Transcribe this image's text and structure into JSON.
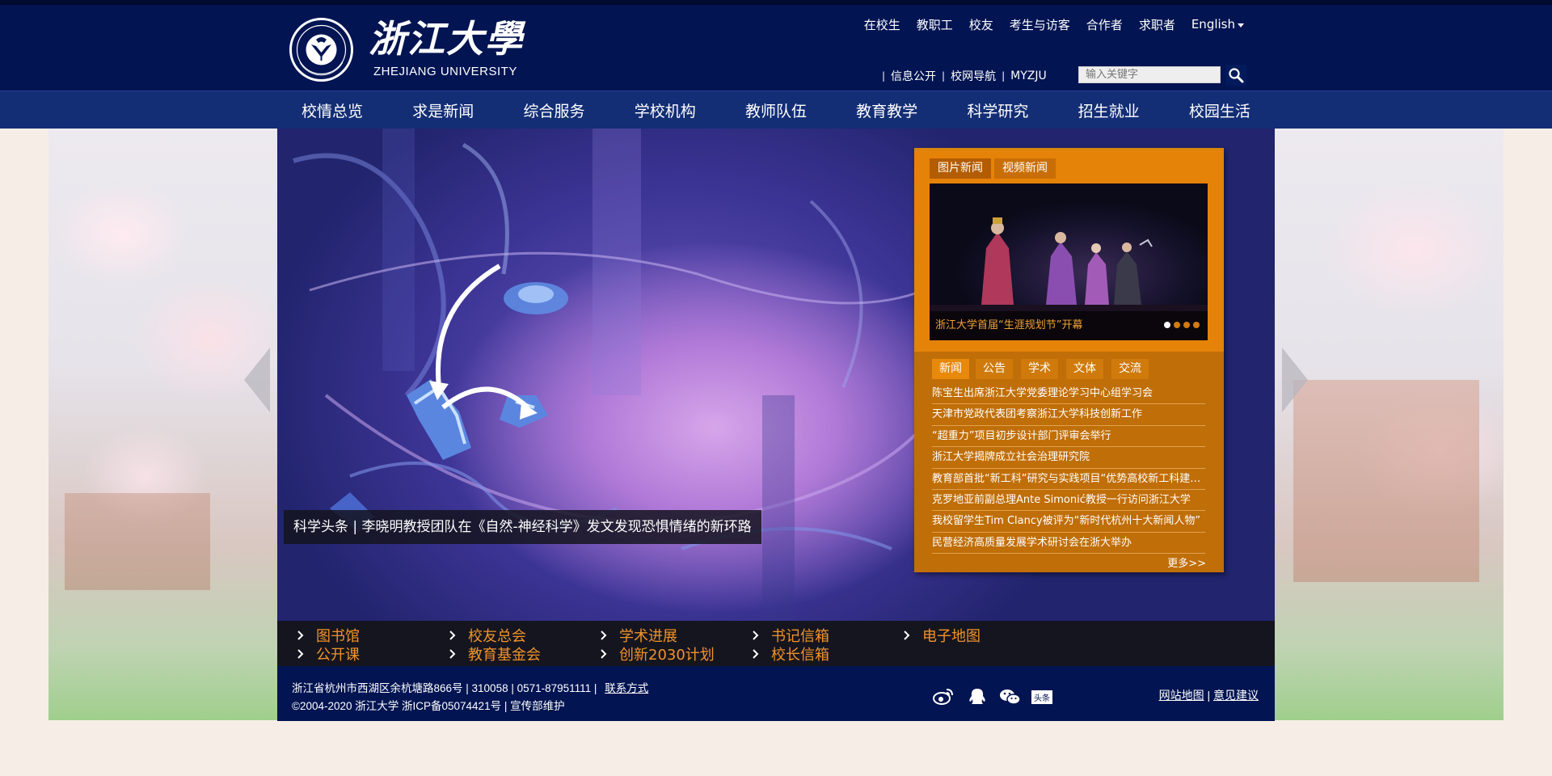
{
  "logo": {
    "name_cn": "浙江大學",
    "name_en": "ZHEJIANG UNIVERSITY",
    "seal_text": "ZHEJIANG UNIVERSITY"
  },
  "topnav": {
    "items": [
      "在校生",
      "教职工",
      "校友",
      "考生与访客",
      "合作者",
      "求职者"
    ],
    "language": "English"
  },
  "utilnav": {
    "items": [
      "信息公开",
      "校网导航",
      "MYZJU"
    ]
  },
  "search": {
    "placeholder": "输入关键字"
  },
  "mainnav": {
    "items": [
      "校情总览",
      "求是新闻",
      "综合服务",
      "学校机构",
      "教师队伍",
      "教育教学",
      "科学研究",
      "招生就业",
      "校园生活"
    ]
  },
  "hero": {
    "caption": "科学头条 | 李晓明教授团队在《自然-神经科学》发文发现恐惧情绪的新环路"
  },
  "news_panel": {
    "photo_tabs": [
      "图片新闻",
      "视频新闻"
    ],
    "photo_caption": "浙江大学首届“生涯规划节”开幕",
    "slide_dots": 4,
    "active_dot": 0,
    "news_tabs": [
      "新闻",
      "公告",
      "学术",
      "文体",
      "交流"
    ],
    "news_items": [
      "陈宝生出席浙江大学党委理论学习中心组学习会",
      "天津市党政代表团考察浙江大学科技创新工作",
      "“超重力”项目初步设计部门评审会举行",
      "浙江大学揭牌成立社会治理研究院",
      "教育部首批“新工科”研究与实践项目“优势高校新工科建设”...",
      "克罗地亚前副总理Ante Simonić教授一行访问浙江大学",
      "我校留学生Tim Clancy被评为“新时代杭州十大新闻人物”",
      "民营经济高质量发展学术研讨会在浙大举办"
    ],
    "more": "更多>>"
  },
  "quicklinks": {
    "row1": [
      "图书馆",
      "校友总会",
      "学术进展",
      "书记信箱",
      "电子地图"
    ],
    "row2": [
      "公开课",
      "教育基金会",
      "创新2030计划",
      "校长信箱"
    ]
  },
  "footer": {
    "address": "浙江省杭州市西湖区余杭塘路866号 | 310058 | 0571-87951111  |",
    "contact": "联系方式",
    "copyright": "©2004-2020 浙江大学 浙ICP备05074421号 | 宣传部维护",
    "sitemap": "网站地图",
    "divider": "|",
    "feedback": "意见建议",
    "toutiao_label": "头条",
    "social_icons": [
      "weibo-icon",
      "qq-icon",
      "wechat-icon",
      "toutiao-icon"
    ]
  },
  "colors": {
    "header": "#021452",
    "nav": "#132e75",
    "accent_orange": "#e58308",
    "panel_orange": "#c06e07",
    "link_orange": "#f0932a"
  }
}
